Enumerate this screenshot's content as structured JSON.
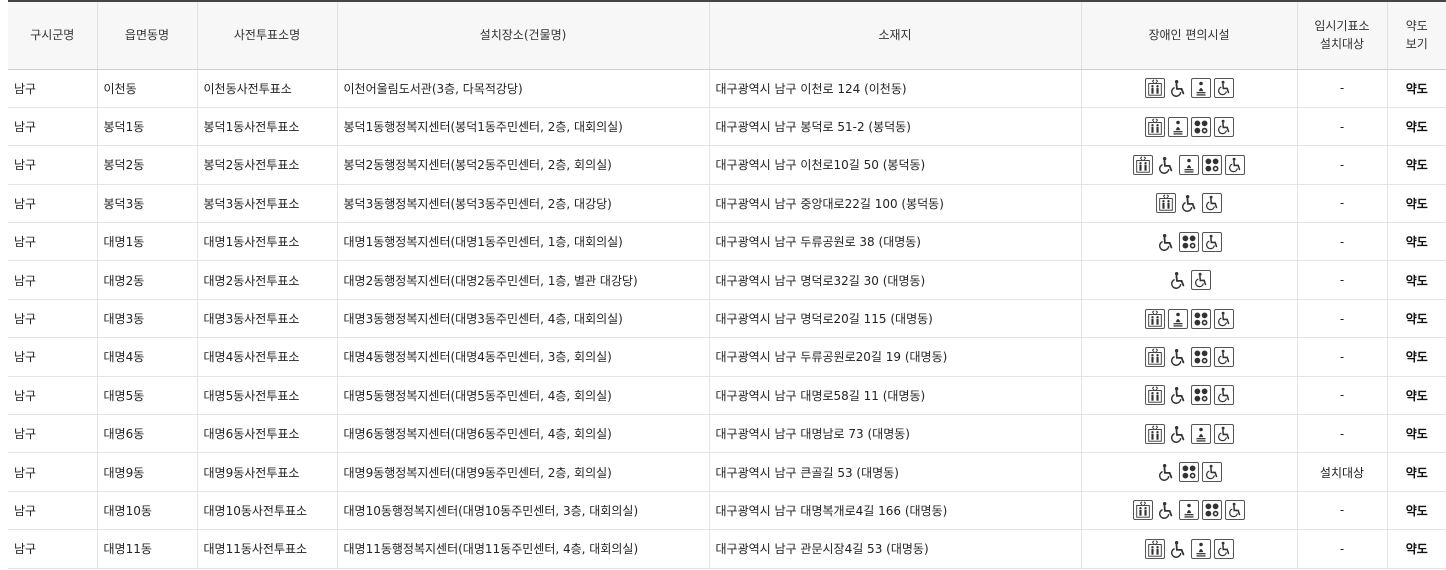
{
  "headers": {
    "district": "구시군명",
    "town": "읍면동명",
    "station": "사전투표소명",
    "location": "설치장소(건물명)",
    "address": "소재지",
    "facilities": "장애인 편의시설",
    "temp_line1": "임시기표소",
    "temp_line2": "설치대상",
    "map_line1": "약도",
    "map_line2": "보기"
  },
  "facility_icons": {
    "E": "elevator-icon",
    "W": "wheelchair-icon",
    "T": "seat-lift-icon",
    "B": "braille-icon",
    "R": "accessible-restroom-icon"
  },
  "rows": [
    {
      "district": "남구",
      "town": "이천동",
      "station": "이천동사전투표소",
      "location": "이천어울림도서관(3층, 다목적강당)",
      "address": "대구광역시 남구 이천로 124 (이천동)",
      "icons": [
        "E",
        "W",
        "T",
        "R"
      ],
      "temp": "-",
      "map": "약도"
    },
    {
      "district": "남구",
      "town": "봉덕1동",
      "station": "봉덕1동사전투표소",
      "location": "봉덕1동행정복지센터(봉덕1동주민센터, 2층, 대회의실)",
      "address": "대구광역시 남구 봉덕로 51-2 (봉덕동)",
      "icons": [
        "E",
        "T",
        "B",
        "R"
      ],
      "temp": "-",
      "map": "약도"
    },
    {
      "district": "남구",
      "town": "봉덕2동",
      "station": "봉덕2동사전투표소",
      "location": "봉덕2동행정복지센터(봉덕2동주민센터, 2층, 회의실)",
      "address": "대구광역시 남구 이천로10길 50 (봉덕동)",
      "icons": [
        "E",
        "W",
        "T",
        "B",
        "R"
      ],
      "temp": "-",
      "map": "약도"
    },
    {
      "district": "남구",
      "town": "봉덕3동",
      "station": "봉덕3동사전투표소",
      "location": "봉덕3동행정복지센터(봉덕3동주민센터, 2층, 대강당)",
      "address": "대구광역시 남구 중앙대로22길 100 (봉덕동)",
      "icons": [
        "E",
        "W",
        "R"
      ],
      "temp": "-",
      "map": "약도"
    },
    {
      "district": "남구",
      "town": "대명1동",
      "station": "대명1동사전투표소",
      "location": "대명1동행정복지센터(대명1동주민센터, 1층, 대회의실)",
      "address": "대구광역시 남구 두류공원로 38 (대명동)",
      "icons": [
        "W",
        "B",
        "R"
      ],
      "temp": "-",
      "map": "약도"
    },
    {
      "district": "남구",
      "town": "대명2동",
      "station": "대명2동사전투표소",
      "location": "대명2동행정복지센터(대명2동주민센터, 1층, 별관 대강당)",
      "address": "대구광역시 남구 명덕로32길 30 (대명동)",
      "icons": [
        "W",
        "R"
      ],
      "temp": "-",
      "map": "약도"
    },
    {
      "district": "남구",
      "town": "대명3동",
      "station": "대명3동사전투표소",
      "location": "대명3동행정복지센터(대명3동주민센터, 4층, 대회의실)",
      "address": "대구광역시 남구 명덕로20길 115 (대명동)",
      "icons": [
        "E",
        "T",
        "B",
        "R"
      ],
      "temp": "-",
      "map": "약도"
    },
    {
      "district": "남구",
      "town": "대명4동",
      "station": "대명4동사전투표소",
      "location": "대명4동행정복지센터(대명4동주민센터, 3층, 회의실)",
      "address": "대구광역시 남구 두류공원로20길 19 (대명동)",
      "icons": [
        "E",
        "W",
        "B",
        "R"
      ],
      "temp": "-",
      "map": "약도"
    },
    {
      "district": "남구",
      "town": "대명5동",
      "station": "대명5동사전투표소",
      "location": "대명5동행정복지센터(대명5동주민센터, 4층, 회의실)",
      "address": "대구광역시 남구 대명로58길 11 (대명동)",
      "icons": [
        "E",
        "W",
        "B",
        "R"
      ],
      "temp": "-",
      "map": "약도"
    },
    {
      "district": "남구",
      "town": "대명6동",
      "station": "대명6동사전투표소",
      "location": "대명6동행정복지센터(대명6동주민센터, 4층, 회의실)",
      "address": "대구광역시 남구 대명남로 73 (대명동)",
      "icons": [
        "E",
        "W",
        "T",
        "R"
      ],
      "temp": "-",
      "map": "약도"
    },
    {
      "district": "남구",
      "town": "대명9동",
      "station": "대명9동사전투표소",
      "location": "대명9동행정복지센터(대명9동주민센터, 2층, 회의실)",
      "address": "대구광역시 남구 큰골길 53 (대명동)",
      "icons": [
        "W",
        "B",
        "R"
      ],
      "temp": "설치대상",
      "map": "약도"
    },
    {
      "district": "남구",
      "town": "대명10동",
      "station": "대명10동사전투표소",
      "location": "대명10동행정복지센터(대명10동주민센터, 3층, 대회의실)",
      "address": "대구광역시 남구 대명복개로4길 166 (대명동)",
      "icons": [
        "E",
        "W",
        "T",
        "B",
        "R"
      ],
      "temp": "-",
      "map": "약도"
    },
    {
      "district": "남구",
      "town": "대명11동",
      "station": "대명11동사전투표소",
      "location": "대명11동행정복지센터(대명11동주민센터, 4층, 대회의실)",
      "address": "대구광역시 남구 관문시장4길 53 (대명동)",
      "icons": [
        "E",
        "W",
        "T",
        "R"
      ],
      "temp": "-",
      "map": "약도"
    }
  ]
}
